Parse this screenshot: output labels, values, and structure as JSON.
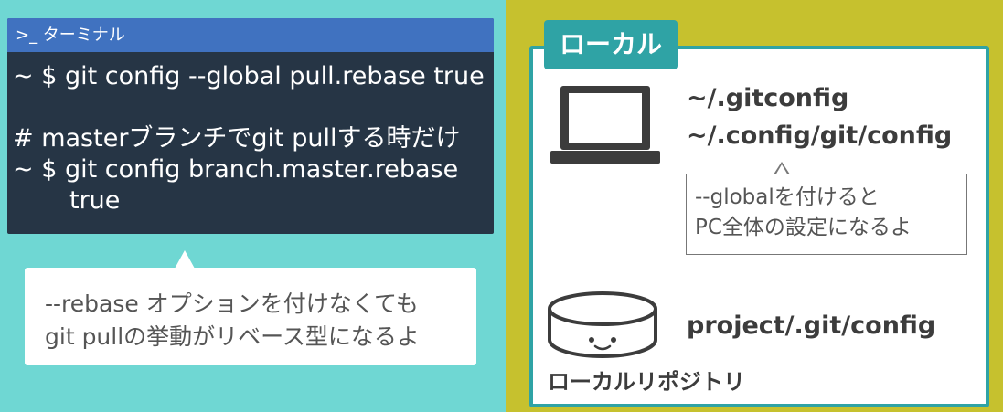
{
  "terminal": {
    "title": ">_ ターミナル",
    "lines": [
      "~ $ git config --global pull.rebase true",
      "# masterブランチでgit pullする時だけ",
      "~ $ git config branch.master.rebase",
      "true"
    ]
  },
  "callout_rebase": {
    "line1": "--rebase オプションを付けなくても",
    "line2": "git pullの挙動がリベース型になるよ"
  },
  "local": {
    "label": "ローカル",
    "global_path1": "~/.gitconfig",
    "global_path2": "~/.config/git/config",
    "callout_line1": "--globalを付けると",
    "callout_line2": "PC全体の設定になるよ",
    "repo_path": "project/.git/config",
    "repo_label": "ローカルリポジトリ"
  },
  "colors": {
    "left_bg": "#6fd7d3",
    "right_bg": "#c6c12e",
    "terminal_bg": "#263545",
    "terminal_title_bg": "#4072c0",
    "accent_teal": "#2fa3a5"
  }
}
